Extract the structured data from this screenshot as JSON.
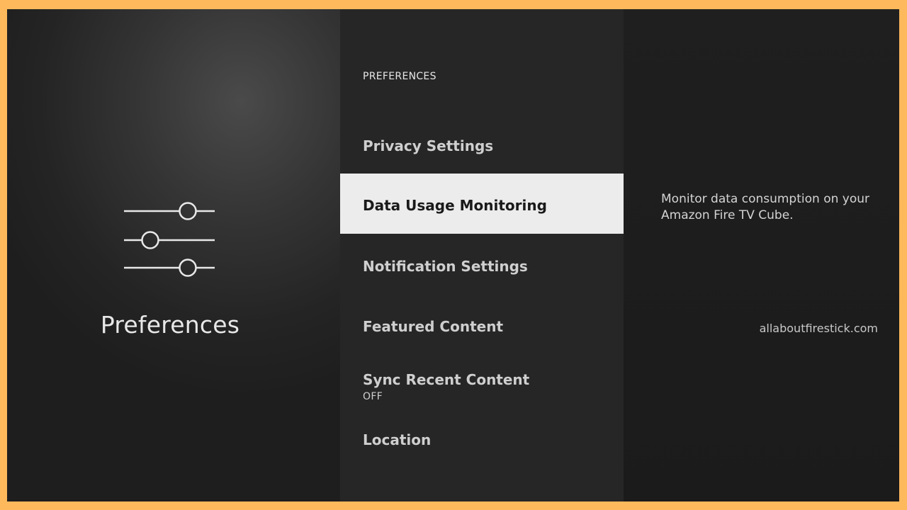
{
  "left": {
    "icon": "sliders-icon",
    "title": "Preferences"
  },
  "menu": {
    "section_title": "PREFERENCES",
    "items": [
      {
        "label": "Privacy Settings",
        "sub": ""
      },
      {
        "label": "Data Usage Monitoring",
        "sub": "",
        "selected": true
      },
      {
        "label": "Notification Settings",
        "sub": ""
      },
      {
        "label": "Featured Content",
        "sub": ""
      },
      {
        "label": "Sync Recent Content",
        "sub": "OFF"
      },
      {
        "label": "Location",
        "sub": ""
      }
    ]
  },
  "detail": {
    "description": "Monitor data consumption on your Amazon Fire TV Cube."
  },
  "watermark": "allaboutfirestick.com",
  "colors": {
    "border": "#FDB95C",
    "selected_bg": "#ECECEC",
    "selected_text": "#1A1A1A"
  }
}
